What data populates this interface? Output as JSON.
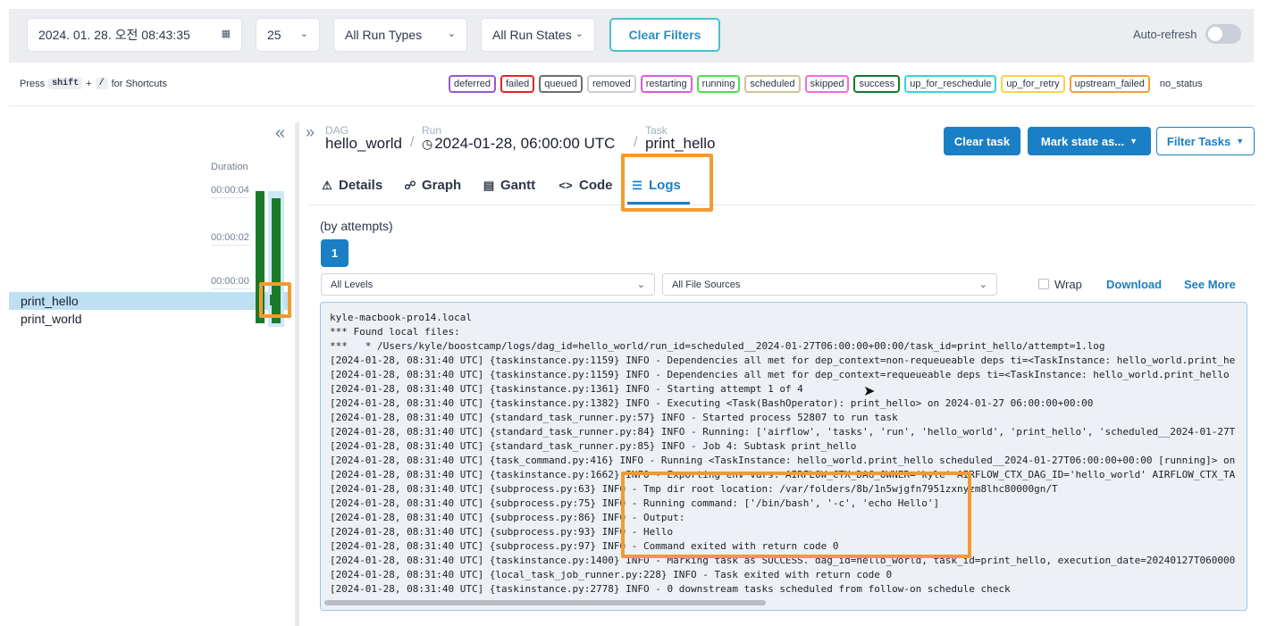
{
  "filters": {
    "datetime": "2024. 01. 28. 오전 08:43:35",
    "page_size": "25",
    "run_types": "All Run Types",
    "run_states": "All Run States",
    "clear_filters": "Clear Filters",
    "auto_refresh": "Auto-refresh"
  },
  "shortcut": {
    "press": "Press",
    "shift": "shift",
    "plus": "+",
    "slash": "/",
    "suffix": "for Shortcuts"
  },
  "legend": [
    {
      "label": "deferred",
      "color": "#9b59d0"
    },
    {
      "label": "failed",
      "color": "#e0242b"
    },
    {
      "label": "queued",
      "color": "#6e6e6e"
    },
    {
      "label": "removed",
      "color": "#cfcfcf"
    },
    {
      "label": "restarting",
      "color": "#d65fd6"
    },
    {
      "label": "running",
      "color": "#4ee04e"
    },
    {
      "label": "scheduled",
      "color": "#cfc29c"
    },
    {
      "label": "skipped",
      "color": "#f06adf"
    },
    {
      "label": "success",
      "color": "#137a2a"
    },
    {
      "label": "up_for_reschedule",
      "color": "#39d4d4"
    },
    {
      "label": "up_for_retry",
      "color": "#f5d44b"
    },
    {
      "label": "upstream_failed",
      "color": "#f0a035"
    },
    {
      "label": "no_status",
      "color": "transparent"
    }
  ],
  "grid": {
    "duration_label": "Duration",
    "ticks": [
      "00:00:04",
      "00:00:02",
      "00:00:00"
    ],
    "tasks": [
      "print_hello",
      "print_world"
    ]
  },
  "breadcrumb": {
    "dag_label": "DAG",
    "dag": "hello_world",
    "run_label": "Run",
    "run": "2024-01-28, 06:00:00 UTC",
    "task_label": "Task",
    "task": "print_hello"
  },
  "actions": {
    "clear_task": "Clear task",
    "mark_state": "Mark state as...",
    "filter_tasks": "Filter Tasks"
  },
  "tabs": [
    "Details",
    "Graph",
    "Gantt",
    "Code",
    "Logs"
  ],
  "logs": {
    "attempts_label": "(by attempts)",
    "attempt": "1",
    "levels": "All Levels",
    "sources": "All File Sources",
    "wrap": "Wrap",
    "download": "Download",
    "see_more": "See More",
    "lines": [
      "kyle-macbook-pro14.local",
      "*** Found local files:",
      "***   * /Users/kyle/boostcamp/logs/dag_id=hello_world/run_id=scheduled__2024-01-27T06:00:00+00:00/task_id=print_hello/attempt=1.log",
      "[2024-01-28, 08:31:40 UTC] {taskinstance.py:1159} INFO - Dependencies all met for dep_context=non-requeueable deps ti=<TaskInstance: hello_world.print_he",
      "[2024-01-28, 08:31:40 UTC] {taskinstance.py:1159} INFO - Dependencies all met for dep_context=requeueable deps ti=<TaskInstance: hello_world.print_hello",
      "[2024-01-28, 08:31:40 UTC] {taskinstance.py:1361} INFO - Starting attempt 1 of 4",
      "[2024-01-28, 08:31:40 UTC] {taskinstance.py:1382} INFO - Executing <Task(BashOperator): print_hello> on 2024-01-27 06:00:00+00:00",
      "[2024-01-28, 08:31:40 UTC] {standard_task_runner.py:57} INFO - Started process 52807 to run task",
      "[2024-01-28, 08:31:40 UTC] {standard_task_runner.py:84} INFO - Running: ['airflow', 'tasks', 'run', 'hello_world', 'print_hello', 'scheduled__2024-01-27T",
      "[2024-01-28, 08:31:40 UTC] {standard_task_runner.py:85} INFO - Job 4: Subtask print_hello",
      "[2024-01-28, 08:31:40 UTC] {task_command.py:416} INFO - Running <TaskInstance: hello_world.print_hello scheduled__2024-01-27T06:00:00+00:00 [running]> on",
      "[2024-01-28, 08:31:40 UTC] {taskinstance.py:1662} INFO - Exporting env vars: AIRFLOW_CTX_DAG_OWNER='kyle' AIRFLOW_CTX_DAG_ID='hello_world' AIRFLOW_CTX_TA",
      "[2024-01-28, 08:31:40 UTC] {subprocess.py:63} INFO - Tmp dir root location: /var/folders/8b/1n5wjgfn7951zxnyzm8lhc80000gn/T",
      "[2024-01-28, 08:31:40 UTC] {subprocess.py:75} INFO - Running command: ['/bin/bash', '-c', 'echo Hello']",
      "[2024-01-28, 08:31:40 UTC] {subprocess.py:86} INFO - Output:",
      "[2024-01-28, 08:31:40 UTC] {subprocess.py:93} INFO - Hello",
      "[2024-01-28, 08:31:40 UTC] {subprocess.py:97} INFO - Command exited with return code 0",
      "[2024-01-28, 08:31:40 UTC] {taskinstance.py:1400} INFO - Marking task as SUCCESS. dag_id=hello_world, task_id=print_hello, execution_date=20240127T060000",
      "[2024-01-28, 08:31:40 UTC] {local_task_job_runner.py:228} INFO - Task exited with return code 0",
      "[2024-01-28, 08:31:40 UTC] {taskinstance.py:2778} INFO - 0 downstream tasks scheduled from follow-on schedule check"
    ]
  },
  "colors": {
    "accent": "#1a7fc4",
    "success": "#1a7a2a",
    "highlight": "#f39a30"
  }
}
